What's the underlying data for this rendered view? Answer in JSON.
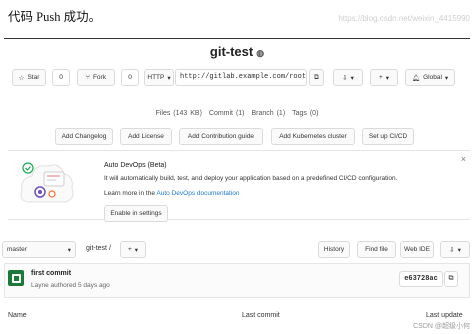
{
  "doc": {
    "caption": "代码 Push 成功。",
    "watermark_top": "https://blog.csdn.net/weixin_4415990",
    "watermark_bottom": "CSDN @超级小何"
  },
  "project": {
    "name": "git-test",
    "visibility_icon": "globe-icon"
  },
  "actions": {
    "star_label": "Star",
    "star_count": "0",
    "fork_label": "Fork",
    "fork_count": "0",
    "protocol_label": "HTTP",
    "clone_url": "http://gitlab.example.com/root/git-test.git",
    "notification_label": "Global"
  },
  "stats": {
    "files": "Files (143 KB)",
    "commits": "Commit (1)",
    "branches": "Branch (1)",
    "tags": "Tags (0)"
  },
  "quick_buttons": [
    "Add Changelog",
    "Add License",
    "Add Contribution guide",
    "Add Kubernetes cluster",
    "Set up CI/CD"
  ],
  "devops": {
    "title": "Auto DevOps (Beta)",
    "description": "It will automatically build, test, and deploy your application based on a predefined CI/CD configuration.",
    "learn_prefix": "Learn more in the",
    "learn_link": "Auto DevOps documentation",
    "enable_button": "Enable in settings"
  },
  "tree": {
    "branch": "master",
    "path": "git-test",
    "separator": "/",
    "add": "+",
    "history": "History",
    "find_file": "Find file",
    "web_ide": "Web IDE"
  },
  "last_commit": {
    "title": "first commit",
    "meta": "Layne authored 5 days ago",
    "sha": "e63728ac"
  },
  "table": {
    "col_name": "Name",
    "col_commit": "Last commit",
    "col_update": "Last update"
  },
  "colors": {
    "link": "#1f78d1",
    "avatar": "#1b7a3a"
  }
}
